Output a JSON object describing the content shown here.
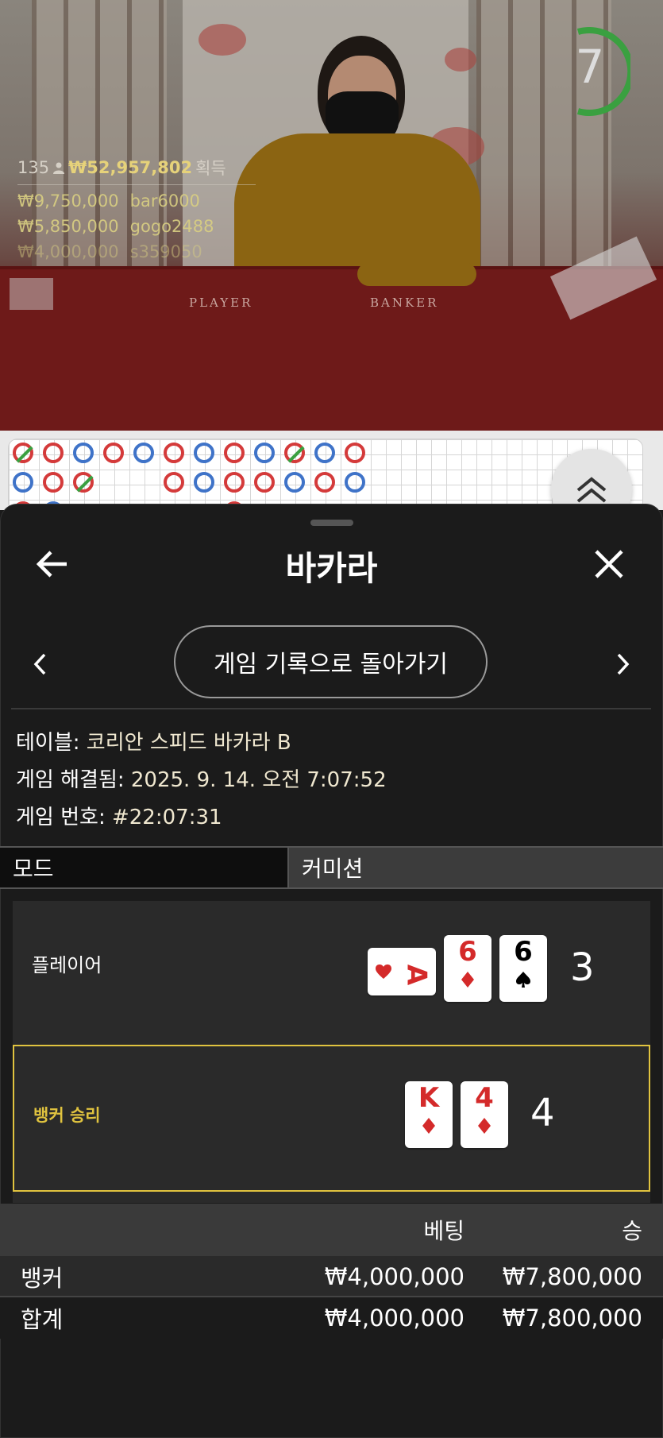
{
  "stream": {
    "timer_value": "7",
    "table_labels": {
      "player": "PLAYER",
      "banker": "BANKER"
    },
    "winners": {
      "players_count": "135",
      "total_won": "₩52,957,802",
      "total_label": "획득",
      "top": [
        {
          "amount": "₩9,750,000",
          "user": "bar6000"
        },
        {
          "amount": "₩5,850,000",
          "user": "gogo2488"
        },
        {
          "amount": "₩4,000,000",
          "user": "s359050"
        }
      ]
    }
  },
  "sheet": {
    "title": "바카라",
    "back_icon": "arrow-left-icon",
    "close_icon": "close-icon",
    "history_button": "게임 기록으로 돌아가기",
    "info": {
      "table_label": "테이블:",
      "table_value": "코리안 스피드 바카라 B",
      "resolved_label": "게임 해결됨:",
      "resolved_value": "2025. 9. 14. 오전 7:07:52",
      "game_no_label": "게임 번호:",
      "game_no_value": "#22:07:31"
    },
    "tabs": {
      "mode": "모드",
      "commission": "커미션"
    },
    "result": {
      "player": {
        "label": "플레이어",
        "score": "3",
        "cards": [
          {
            "rank": "A",
            "suit": "heart",
            "color": "#d42a2a",
            "sideways": true
          },
          {
            "rank": "6",
            "suit": "diamond",
            "color": "#d42a2a"
          },
          {
            "rank": "6",
            "suit": "spade",
            "color": "#000000"
          }
        ]
      },
      "banker": {
        "label": "뱅커 승리",
        "score": "4",
        "cards": [
          {
            "rank": "K",
            "suit": "diamond",
            "color": "#d42a2a"
          },
          {
            "rank": "4",
            "suit": "diamond",
            "color": "#d42a2a"
          }
        ]
      }
    },
    "bets": {
      "col_bet": "베팅",
      "col_win": "승",
      "rows": [
        {
          "name": "뱅커",
          "bet": "₩4,000,000",
          "win": "₩7,800,000"
        }
      ],
      "total": {
        "name": "합계",
        "bet": "₩4,000,000",
        "win": "₩7,800,000"
      }
    },
    "colors": {
      "winner_border": "#e0c33f",
      "winner_text": "#e0c33f",
      "red_suit": "#d42a2a"
    }
  }
}
